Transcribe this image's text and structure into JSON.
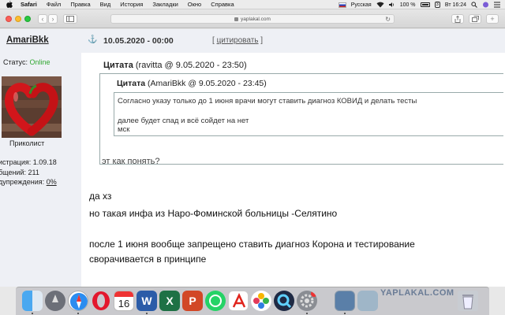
{
  "menubar": {
    "app_name": "Safari",
    "items": [
      "Файл",
      "Правка",
      "Вид",
      "История",
      "Закладки",
      "Окно",
      "Справка"
    ],
    "keyboard_layout": "Русская",
    "battery": "100 %",
    "clock": "Вт 16:24"
  },
  "browser": {
    "url": "yaplakal.com"
  },
  "user": {
    "name": "AmariBkk",
    "status_label": "Статус:",
    "status_value": "Online",
    "title": "Приколист",
    "info_lines": [
      "истрация: 1.09.18",
      "бщений: 211",
      "дупреждения: "
    ],
    "warnings": "0%"
  },
  "post": {
    "date": "10.05.2020 - 00:00",
    "cite_open": "[ ",
    "cite_label": "цитировать",
    "cite_close": " ]",
    "quote1": {
      "label": "Цитата",
      "meta": " (ravitta @ 9.05.2020 - 23:50)",
      "text": "эт как понять?"
    },
    "quote2": {
      "label": "Цитата",
      "meta": " (AmariBkk @ 9.05.2020 - 23:45)",
      "lines": [
        "Согласно указу только до 1 июня врачи могут ставить диагноз КОВИД и делать тесты",
        "далее будет спад и всё сойдет на нет",
        "мск"
      ]
    },
    "body": [
      "да хз",
      "но такая инфа из Наро-Фоминской больницы -Селятино",
      "после 1 июня вообще запрещено ставить диагноз Корона и тестирование",
      "сворачивается в принципе"
    ]
  },
  "dock": {
    "apps": [
      "finder-icon",
      "launchpad-icon",
      "safari-icon",
      "opera-icon",
      "calendar-icon",
      "word-icon",
      "excel-icon",
      "powerpoint-icon",
      "whatsapp-icon",
      "acrobat-icon",
      "photos-icon",
      "quicktime-icon",
      "system-preferences-icon",
      "preview-icon",
      "image-capture-icon",
      "trash-icon"
    ],
    "calendar_day": "16",
    "watermark": "YAPLAKAL.COM"
  },
  "colors": {
    "online": "#2fa72f",
    "link": "#2a6fb5",
    "page_bg": "#eef0f5"
  }
}
